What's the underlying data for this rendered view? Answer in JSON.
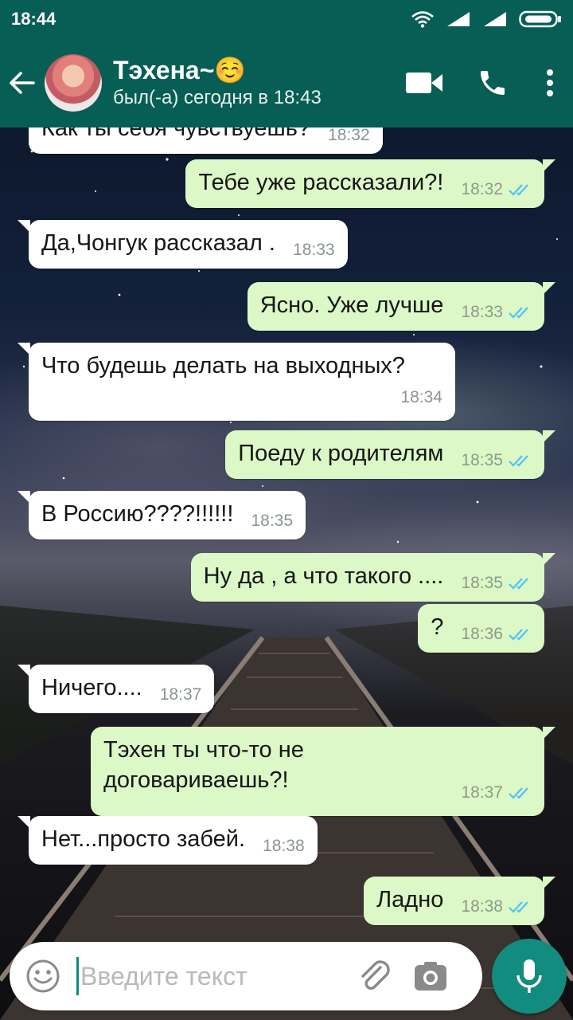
{
  "status_bar": {
    "time": "18:44"
  },
  "header": {
    "name": "Тэхена~☺️",
    "last_seen": "был(-а) сегодня в 18:43"
  },
  "messages": [
    {
      "dir": "in",
      "text": "Как ты себя чувствуешь?",
      "time": "18:32",
      "partial": true
    },
    {
      "dir": "out",
      "text": "Тебе уже рассказали?!",
      "time": "18:32",
      "ticks": "read"
    },
    {
      "dir": "in",
      "text": "Да,Чонгук рассказал .",
      "time": "18:33"
    },
    {
      "dir": "out",
      "text": "Ясно. Уже лучше",
      "time": "18:33",
      "ticks": "read"
    },
    {
      "dir": "in",
      "text": "Что будешь делать на выходных?",
      "time": "18:34"
    },
    {
      "dir": "out",
      "text": "Поеду к родителям",
      "time": "18:35",
      "ticks": "read"
    },
    {
      "dir": "in",
      "text": "В Россию????!!!!!!",
      "time": "18:35"
    },
    {
      "dir": "out",
      "text": "Ну да , а что такого ....",
      "time": "18:35",
      "ticks": "read"
    },
    {
      "dir": "out",
      "text": "?",
      "time": "18:36",
      "ticks": "read"
    },
    {
      "dir": "in",
      "text": "Ничего....",
      "time": "18:37"
    },
    {
      "dir": "out",
      "text": "Тэхен ты что-то не договариваешь?!",
      "time": "18:37",
      "ticks": "read"
    },
    {
      "dir": "in",
      "text": "Нет...просто забей.",
      "time": "18:38"
    },
    {
      "dir": "out",
      "text": "Ладно",
      "time": "18:38",
      "ticks": "read"
    }
  ],
  "composer": {
    "placeholder": "Введите текст"
  },
  "colors": {
    "header": "#075e54",
    "outgoing_bubble": "#dcf8c6",
    "incoming_bubble": "#ffffff",
    "read_ticks": "#4fc3f7",
    "mic_button": "#128c7e"
  },
  "icons": {
    "back": "arrow-left-icon",
    "video": "videocam-icon",
    "call": "phone-icon",
    "menu": "more-vert-icon",
    "emoji": "emoji-icon",
    "attach": "paperclip-icon",
    "camera": "camera-icon",
    "mic": "mic-icon"
  }
}
